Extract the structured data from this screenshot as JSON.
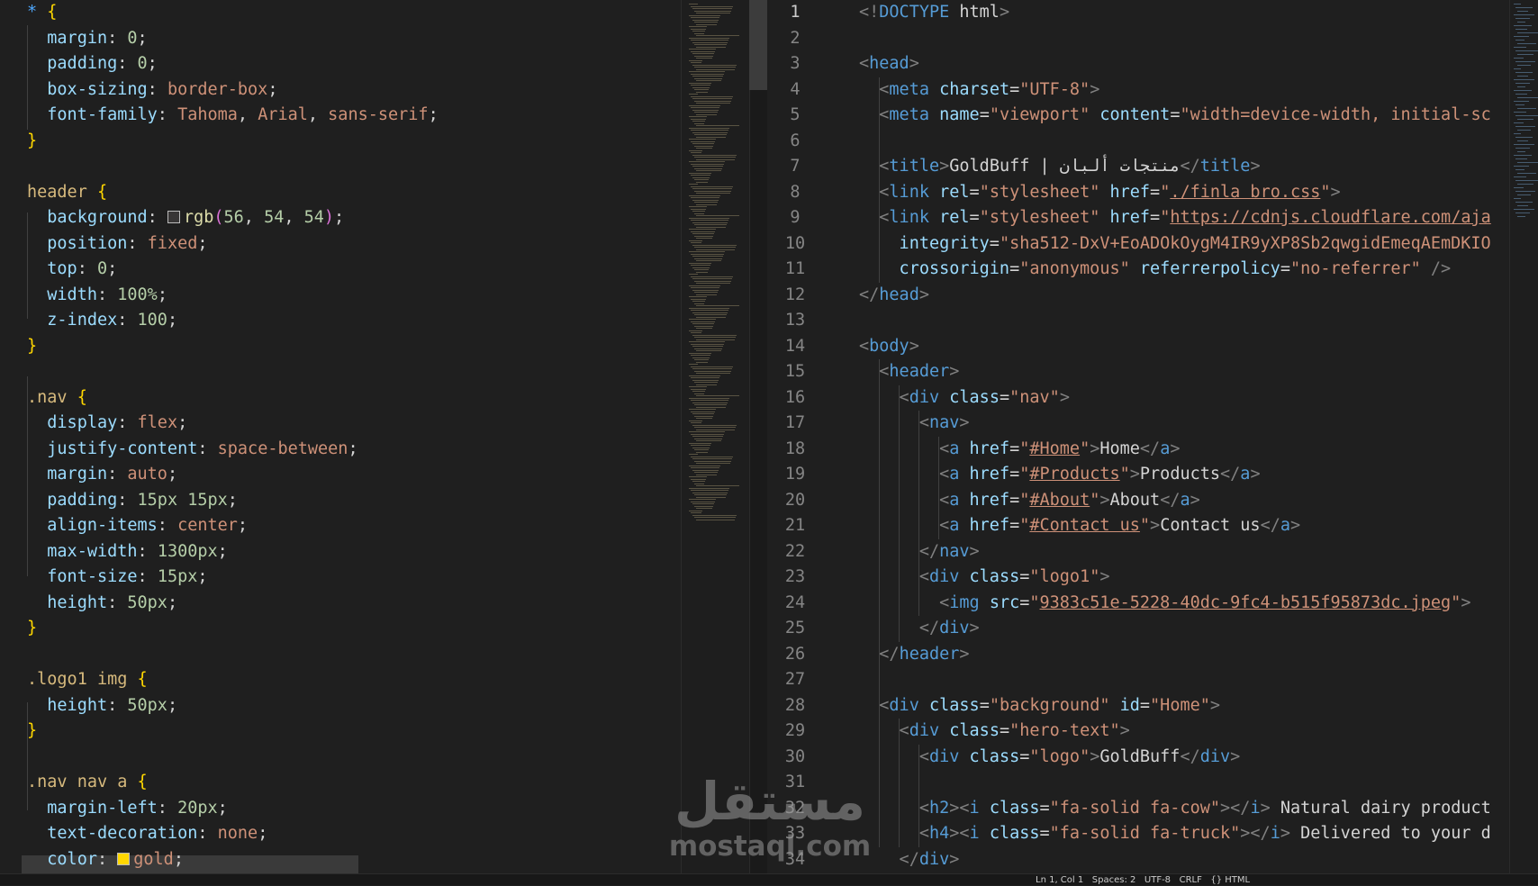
{
  "css_editor": {
    "lines": [
      [
        [
          "*",
          "star"
        ],
        [
          " ",
          ""
        ],
        [
          "{",
          "brace"
        ]
      ],
      [
        [
          "  margin",
          "prop"
        ],
        [
          ": ",
          "pn"
        ],
        [
          "0",
          "vnum"
        ],
        [
          ";",
          "pn"
        ]
      ],
      [
        [
          "  padding",
          "prop"
        ],
        [
          ": ",
          "pn"
        ],
        [
          "0",
          "vnum"
        ],
        [
          ";",
          "pn"
        ]
      ],
      [
        [
          "  box-sizing",
          "prop"
        ],
        [
          ": ",
          "pn"
        ],
        [
          "border-box",
          "vword"
        ],
        [
          ";",
          "pn"
        ]
      ],
      [
        [
          "  font-family",
          "prop"
        ],
        [
          ": ",
          "pn"
        ],
        [
          "Tahoma",
          "vword"
        ],
        [
          ", ",
          "pn"
        ],
        [
          "Arial",
          "vword"
        ],
        [
          ", ",
          "pn"
        ],
        [
          "sans-serif",
          "vword"
        ],
        [
          ";",
          "pn"
        ]
      ],
      [
        [
          "}",
          "brace"
        ]
      ],
      [],
      [
        [
          "header",
          "sel"
        ],
        [
          " ",
          ""
        ],
        [
          "{",
          "brace"
        ]
      ],
      [
        [
          "  background",
          "prop"
        ],
        [
          ": ",
          "pn"
        ],
        [
          "@swatch:#383636",
          ""
        ],
        [
          "rgb",
          "vfn"
        ],
        [
          "(",
          "par"
        ],
        [
          "56",
          "vnum"
        ],
        [
          ", ",
          "pn"
        ],
        [
          "54",
          "vnum"
        ],
        [
          ", ",
          "pn"
        ],
        [
          "54",
          "vnum"
        ],
        [
          ")",
          "par"
        ],
        [
          ";",
          "pn"
        ]
      ],
      [
        [
          "  position",
          "prop"
        ],
        [
          ": ",
          "pn"
        ],
        [
          "fixed",
          "vword"
        ],
        [
          ";",
          "pn"
        ]
      ],
      [
        [
          "  top",
          "prop"
        ],
        [
          ": ",
          "pn"
        ],
        [
          "0",
          "vnum"
        ],
        [
          ";",
          "pn"
        ]
      ],
      [
        [
          "  width",
          "prop"
        ],
        [
          ": ",
          "pn"
        ],
        [
          "100%",
          "vnum"
        ],
        [
          ";",
          "pn"
        ]
      ],
      [
        [
          "  z-index",
          "prop"
        ],
        [
          ": ",
          "pn"
        ],
        [
          "100",
          "vnum"
        ],
        [
          ";",
          "pn"
        ]
      ],
      [
        [
          "}",
          "brace"
        ]
      ],
      [],
      [
        [
          ".nav",
          "sel"
        ],
        [
          " ",
          ""
        ],
        [
          "{",
          "brace"
        ]
      ],
      [
        [
          "  display",
          "prop"
        ],
        [
          ": ",
          "pn"
        ],
        [
          "flex",
          "vword"
        ],
        [
          ";",
          "pn"
        ]
      ],
      [
        [
          "  justify-content",
          "prop"
        ],
        [
          ": ",
          "pn"
        ],
        [
          "space-between",
          "vword"
        ],
        [
          ";",
          "pn"
        ]
      ],
      [
        [
          "  margin",
          "prop"
        ],
        [
          ": ",
          "pn"
        ],
        [
          "auto",
          "vword"
        ],
        [
          ";",
          "pn"
        ]
      ],
      [
        [
          "  padding",
          "prop"
        ],
        [
          ": ",
          "pn"
        ],
        [
          "15px 15px",
          "vnum"
        ],
        [
          ";",
          "pn"
        ]
      ],
      [
        [
          "  align-items",
          "prop"
        ],
        [
          ": ",
          "pn"
        ],
        [
          "center",
          "vword"
        ],
        [
          ";",
          "pn"
        ]
      ],
      [
        [
          "  max-width",
          "prop"
        ],
        [
          ": ",
          "pn"
        ],
        [
          "1300px",
          "vnum"
        ],
        [
          ";",
          "pn"
        ]
      ],
      [
        [
          "  font-size",
          "prop"
        ],
        [
          ": ",
          "pn"
        ],
        [
          "15px",
          "vnum"
        ],
        [
          ";",
          "pn"
        ]
      ],
      [
        [
          "  height",
          "prop"
        ],
        [
          ": ",
          "pn"
        ],
        [
          "50px",
          "vnum"
        ],
        [
          ";",
          "pn"
        ]
      ],
      [
        [
          "}",
          "brace"
        ]
      ],
      [],
      [
        [
          ".logo1 img",
          "sel"
        ],
        [
          " ",
          ""
        ],
        [
          "{",
          "brace"
        ]
      ],
      [
        [
          "  height",
          "prop"
        ],
        [
          ": ",
          "pn"
        ],
        [
          "50px",
          "vnum"
        ],
        [
          ";",
          "pn"
        ]
      ],
      [
        [
          "}",
          "brace"
        ]
      ],
      [],
      [
        [
          ".nav nav a",
          "sel"
        ],
        [
          " ",
          ""
        ],
        [
          "{",
          "brace"
        ]
      ],
      [
        [
          "  margin-left",
          "prop"
        ],
        [
          ": ",
          "pn"
        ],
        [
          "20px",
          "vnum"
        ],
        [
          ";",
          "pn"
        ]
      ],
      [
        [
          "  text-decoration",
          "prop"
        ],
        [
          ": ",
          "pn"
        ],
        [
          "none",
          "vword"
        ],
        [
          ";",
          "pn"
        ]
      ],
      [
        [
          "  color",
          "prop"
        ],
        [
          ": ",
          "pn"
        ],
        [
          "@swatch:#ffd700",
          ""
        ],
        [
          "gold",
          "vword"
        ],
        [
          ";",
          "pn"
        ]
      ]
    ]
  },
  "html_editor": {
    "line_numbers": [
      "1",
      "2",
      "3",
      "4",
      "5",
      "6",
      "7",
      "8",
      "9",
      "10",
      "11",
      "12",
      "13",
      "14",
      "15",
      "16",
      "17",
      "18",
      "19",
      "20",
      "21",
      "22",
      "23",
      "24",
      "25",
      "26",
      "27",
      "28",
      "29",
      "30",
      "31",
      "32",
      "33",
      "34"
    ],
    "active_line": "1",
    "lines": [
      [
        [
          "<!",
          "t"
        ],
        [
          "DOCTYPE",
          "kw"
        ],
        [
          " html",
          "tx"
        ],
        [
          ">",
          "t"
        ]
      ],
      [],
      [
        [
          "<",
          "t"
        ],
        [
          "head",
          "tn"
        ],
        [
          ">",
          "t"
        ]
      ],
      [
        [
          "  <",
          "t"
        ],
        [
          "meta",
          "tn"
        ],
        [
          " ",
          ""
        ],
        [
          "charset",
          "an"
        ],
        [
          "=",
          "tx"
        ],
        [
          "\"UTF-8\"",
          "av"
        ],
        [
          ">",
          "t"
        ]
      ],
      [
        [
          "  <",
          "t"
        ],
        [
          "meta",
          "tn"
        ],
        [
          " ",
          ""
        ],
        [
          "name",
          "an"
        ],
        [
          "=",
          "tx"
        ],
        [
          "\"viewport\"",
          "av"
        ],
        [
          " ",
          ""
        ],
        [
          "content",
          "an"
        ],
        [
          "=",
          "tx"
        ],
        [
          "\"width=device-width, initial-sc",
          "av"
        ]
      ],
      [],
      [
        [
          "  <",
          "t"
        ],
        [
          "title",
          "tn"
        ],
        [
          ">",
          "t"
        ],
        [
          "GoldBuff | منتجات ألبان",
          "tx"
        ],
        [
          "</",
          "t"
        ],
        [
          "title",
          "tn"
        ],
        [
          ">",
          "t"
        ]
      ],
      [
        [
          "  <",
          "t"
        ],
        [
          "link",
          "tn"
        ],
        [
          " ",
          ""
        ],
        [
          "rel",
          "an"
        ],
        [
          "=",
          "tx"
        ],
        [
          "\"stylesheet\"",
          "av"
        ],
        [
          " ",
          ""
        ],
        [
          "href",
          "an"
        ],
        [
          "=",
          "tx"
        ],
        [
          "\"",
          "av"
        ],
        [
          "./finla bro.css",
          "av lnk"
        ],
        [
          "\"",
          "av"
        ],
        [
          ">",
          "t"
        ]
      ],
      [
        [
          "  <",
          "t"
        ],
        [
          "link",
          "tn"
        ],
        [
          " ",
          ""
        ],
        [
          "rel",
          "an"
        ],
        [
          "=",
          "tx"
        ],
        [
          "\"stylesheet\"",
          "av"
        ],
        [
          " ",
          ""
        ],
        [
          "href",
          "an"
        ],
        [
          "=",
          "tx"
        ],
        [
          "\"",
          "av"
        ],
        [
          "https://cdnjs.cloudflare.com/aja",
          "av lnk"
        ]
      ],
      [
        [
          "    integrity",
          "an"
        ],
        [
          "=",
          "tx"
        ],
        [
          "\"sha512-DxV+EoADOkOygM4IR9yXP8Sb2qwgidEmeqAEmDKIO",
          "av"
        ]
      ],
      [
        [
          "    crossorigin",
          "an"
        ],
        [
          "=",
          "tx"
        ],
        [
          "\"anonymous\"",
          "av"
        ],
        [
          " ",
          ""
        ],
        [
          "referrerpolicy",
          "an"
        ],
        [
          "=",
          "tx"
        ],
        [
          "\"no-referrer\"",
          "av"
        ],
        [
          " />",
          "t"
        ]
      ],
      [
        [
          "</",
          "t"
        ],
        [
          "head",
          "tn"
        ],
        [
          ">",
          "t"
        ]
      ],
      [],
      [
        [
          "<",
          "t"
        ],
        [
          "body",
          "tn"
        ],
        [
          ">",
          "t"
        ]
      ],
      [
        [
          "  <",
          "t"
        ],
        [
          "header",
          "tn"
        ],
        [
          ">",
          "t"
        ]
      ],
      [
        [
          "    <",
          "t"
        ],
        [
          "div",
          "tn"
        ],
        [
          " ",
          ""
        ],
        [
          "class",
          "an"
        ],
        [
          "=",
          "tx"
        ],
        [
          "\"nav\"",
          "av"
        ],
        [
          ">",
          "t"
        ]
      ],
      [
        [
          "      <",
          "t"
        ],
        [
          "nav",
          "tn"
        ],
        [
          ">",
          "t"
        ]
      ],
      [
        [
          "        <",
          "t"
        ],
        [
          "a",
          "tn"
        ],
        [
          " ",
          ""
        ],
        [
          "href",
          "an"
        ],
        [
          "=",
          "tx"
        ],
        [
          "\"",
          "av"
        ],
        [
          "#Home",
          "av lnk"
        ],
        [
          "\"",
          "av"
        ],
        [
          ">",
          "t"
        ],
        [
          "Home",
          "tx"
        ],
        [
          "</",
          "t"
        ],
        [
          "a",
          "tn"
        ],
        [
          ">",
          "t"
        ]
      ],
      [
        [
          "        <",
          "t"
        ],
        [
          "a",
          "tn"
        ],
        [
          " ",
          ""
        ],
        [
          "href",
          "an"
        ],
        [
          "=",
          "tx"
        ],
        [
          "\"",
          "av"
        ],
        [
          "#Products",
          "av lnk"
        ],
        [
          "\"",
          "av"
        ],
        [
          ">",
          "t"
        ],
        [
          "Products",
          "tx"
        ],
        [
          "</",
          "t"
        ],
        [
          "a",
          "tn"
        ],
        [
          ">",
          "t"
        ]
      ],
      [
        [
          "        <",
          "t"
        ],
        [
          "a",
          "tn"
        ],
        [
          " ",
          ""
        ],
        [
          "href",
          "an"
        ],
        [
          "=",
          "tx"
        ],
        [
          "\"",
          "av"
        ],
        [
          "#About",
          "av lnk"
        ],
        [
          "\"",
          "av"
        ],
        [
          ">",
          "t"
        ],
        [
          "About",
          "tx"
        ],
        [
          "</",
          "t"
        ],
        [
          "a",
          "tn"
        ],
        [
          ">",
          "t"
        ]
      ],
      [
        [
          "        <",
          "t"
        ],
        [
          "a",
          "tn"
        ],
        [
          " ",
          ""
        ],
        [
          "href",
          "an"
        ],
        [
          "=",
          "tx"
        ],
        [
          "\"",
          "av"
        ],
        [
          "#Contact us",
          "av lnk"
        ],
        [
          "\"",
          "av"
        ],
        [
          ">",
          "t"
        ],
        [
          "Contact us",
          "tx"
        ],
        [
          "</",
          "t"
        ],
        [
          "a",
          "tn"
        ],
        [
          ">",
          "t"
        ]
      ],
      [
        [
          "      </",
          "t"
        ],
        [
          "nav",
          "tn"
        ],
        [
          ">",
          "t"
        ]
      ],
      [
        [
          "      <",
          "t"
        ],
        [
          "div",
          "tn"
        ],
        [
          " ",
          ""
        ],
        [
          "class",
          "an"
        ],
        [
          "=",
          "tx"
        ],
        [
          "\"logo1\"",
          "av"
        ],
        [
          ">",
          "t"
        ]
      ],
      [
        [
          "        <",
          "t"
        ],
        [
          "img",
          "tn"
        ],
        [
          " ",
          ""
        ],
        [
          "src",
          "an"
        ],
        [
          "=",
          "tx"
        ],
        [
          "\"",
          "av"
        ],
        [
          "9383c51e-5228-40dc-9fc4-b515f95873dc.jpeg",
          "av lnk"
        ],
        [
          "\"",
          "av"
        ],
        [
          ">",
          "t"
        ]
      ],
      [
        [
          "      </",
          "t"
        ],
        [
          "div",
          "tn"
        ],
        [
          ">",
          "t"
        ]
      ],
      [
        [
          "  </",
          "t"
        ],
        [
          "header",
          "tn"
        ],
        [
          ">",
          "t"
        ]
      ],
      [],
      [
        [
          "  <",
          "t"
        ],
        [
          "div",
          "tn"
        ],
        [
          " ",
          ""
        ],
        [
          "class",
          "an"
        ],
        [
          "=",
          "tx"
        ],
        [
          "\"background\"",
          "av"
        ],
        [
          " ",
          ""
        ],
        [
          "id",
          "an"
        ],
        [
          "=",
          "tx"
        ],
        [
          "\"Home\"",
          "av"
        ],
        [
          ">",
          "t"
        ]
      ],
      [
        [
          "    <",
          "t"
        ],
        [
          "div",
          "tn"
        ],
        [
          " ",
          ""
        ],
        [
          "class",
          "an"
        ],
        [
          "=",
          "tx"
        ],
        [
          "\"hero-text\"",
          "av"
        ],
        [
          ">",
          "t"
        ]
      ],
      [
        [
          "      <",
          "t"
        ],
        [
          "div",
          "tn"
        ],
        [
          " ",
          ""
        ],
        [
          "class",
          "an"
        ],
        [
          "=",
          "tx"
        ],
        [
          "\"logo\"",
          "av"
        ],
        [
          ">",
          "t"
        ],
        [
          "GoldBuff",
          "tx"
        ],
        [
          "</",
          "t"
        ],
        [
          "div",
          "tn"
        ],
        [
          ">",
          "t"
        ]
      ],
      [],
      [
        [
          "      <",
          "t"
        ],
        [
          "h2",
          "tn"
        ],
        [
          "><",
          "t"
        ],
        [
          "i",
          "tn"
        ],
        [
          " ",
          ""
        ],
        [
          "class",
          "an"
        ],
        [
          "=",
          "tx"
        ],
        [
          "\"fa-solid fa-cow\"",
          "av"
        ],
        [
          "></",
          "t"
        ],
        [
          "i",
          "tn"
        ],
        [
          "> ",
          "t"
        ],
        [
          "Natural dairy product",
          "tx"
        ]
      ],
      [
        [
          "      <",
          "t"
        ],
        [
          "h4",
          "tn"
        ],
        [
          "><",
          "t"
        ],
        [
          "i",
          "tn"
        ],
        [
          " ",
          ""
        ],
        [
          "class",
          "an"
        ],
        [
          "=",
          "tx"
        ],
        [
          "\"fa-solid fa-truck\"",
          "av"
        ],
        [
          "></",
          "t"
        ],
        [
          "i",
          "tn"
        ],
        [
          "> ",
          "t"
        ],
        [
          "Delivered to your d",
          "tx"
        ]
      ],
      [
        [
          "    </",
          "t"
        ],
        [
          "div",
          "tn"
        ],
        [
          ">",
          "t"
        ]
      ]
    ]
  },
  "watermark": {
    "brand": "مستقل",
    "domain": "mostaql.com"
  },
  "status_bar": {
    "text": "Ln 1, Col 1   Spaces: 2   UTF-8   CRLF   {} HTML"
  }
}
